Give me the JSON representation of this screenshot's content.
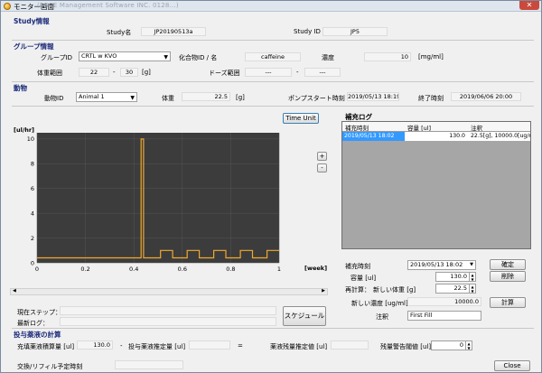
{
  "window": {
    "title": "モニター画面",
    "subtitle": "(FGCE Management Software INC. 0128...)",
    "close_glyph": "✕"
  },
  "study": {
    "section": "Study情報",
    "name_label": "Study名",
    "name_value": "JP20190513a",
    "id_label": "Study ID",
    "id_value": "JP5"
  },
  "group": {
    "section": "グループ情報",
    "group_id_label": "グループID",
    "group_id_value": "CRTL w KVO",
    "compound_label": "化合物ID / 名",
    "compound_value": "caffeine",
    "conc_label": "濃度",
    "conc_value": "10",
    "conc_unit": "[mg/ml]",
    "weight_range_label": "体重範囲",
    "weight_min": "22",
    "weight_sep": "-",
    "weight_max": "30",
    "weight_unit": "[g]",
    "dose_range_label": "ドーズ範囲",
    "dose_min": "---",
    "dose_sep": "-",
    "dose_max": "---"
  },
  "animal": {
    "section": "動物",
    "animal_id_label": "動物ID",
    "animal_id_value": "Animal 1",
    "weight_label": "体重",
    "weight_value": "22.5",
    "weight_unit": "[g]",
    "pump_start_label": "ポンプスタート時刻",
    "pump_start_value": "2019/05/13 18:19",
    "end_label": "終了時刻",
    "end_value": "2019/06/06 20:00"
  },
  "chart_toolbar": {
    "time_unit_label": "Time Unit",
    "zoom_in": "+",
    "zoom_out": "-"
  },
  "chart_data": {
    "type": "line",
    "title": "",
    "ylabel": "[ul/hr]",
    "xlabel": "[week]",
    "xlim": [
      0,
      1.0
    ],
    "ylim": [
      0,
      10.5
    ],
    "x_ticks": [
      "0",
      "0.2",
      "0.4",
      "0.6",
      "0.8",
      "1"
    ],
    "y_ticks": [
      "0",
      "2",
      "4",
      "6",
      "8",
      "10"
    ],
    "grid": true,
    "background": "#3c3c3c",
    "line_color": "#f0a830",
    "series": [
      {
        "name": "",
        "x": [
          0,
          0.43,
          0.43,
          0.44,
          0.44,
          0.51,
          0.51,
          0.56,
          0.56,
          0.62,
          0.62,
          0.67,
          0.67,
          0.73,
          0.73,
          0.78,
          0.78,
          0.84,
          0.84,
          0.89,
          0.89,
          0.95,
          0.95,
          1.0
        ],
        "y": [
          0.4,
          0.4,
          10,
          10,
          0.4,
          0.4,
          1.0,
          1.0,
          0.4,
          0.4,
          1.0,
          1.0,
          0.4,
          0.4,
          1.0,
          1.0,
          0.4,
          0.4,
          1.0,
          1.0,
          0.4,
          0.4,
          1.0,
          1.0
        ]
      }
    ]
  },
  "status": {
    "step_label": "現在ステップ：",
    "step_value": "",
    "log_label": "最新ログ：",
    "log_value": "",
    "schedule_button": "スケジュール"
  },
  "refill_log": {
    "section": "補充ログ",
    "columns": [
      "補充時刻",
      "容量 [ul]",
      "注釈"
    ],
    "rows": [
      {
        "time": "2019/05/13 18:02",
        "volume": "130.0",
        "note": "22.5[g], 10000.0[ug/m..."
      }
    ]
  },
  "refill_form": {
    "time_label": "補充時刻",
    "time_value": "2019/05/13 18:02",
    "confirm_button": "確定",
    "volume_label": "容量 [ul]",
    "volume_value": "130.0",
    "delete_button": "削除",
    "recalc_label": "再計算：",
    "new_weight_label": "新しい体重 [g]",
    "new_weight_value": "22.5",
    "new_conc_label": "新しい濃度 [ug/ml]",
    "new_conc_value": "10000.0",
    "calc_button": "計算",
    "note_label": "注釈",
    "note_value": "First Fill"
  },
  "dose_calc": {
    "section": "投与薬液の計算",
    "filled_label": "充填薬液積算量 [ul]",
    "filled_value": "130.0",
    "minus": "-",
    "dosed_label": "投与薬液推定量 [ul]",
    "dosed_value": "",
    "equals": "=",
    "remaining_label": "薬液残量推定値 [ul]",
    "remaining_value": "",
    "warn_label": "残量警告閾値 [ul]",
    "warn_value": "0",
    "refill_sched_label": "交換/リフィル予定時刻",
    "refill_sched_value": "",
    "close_button": "Close"
  }
}
